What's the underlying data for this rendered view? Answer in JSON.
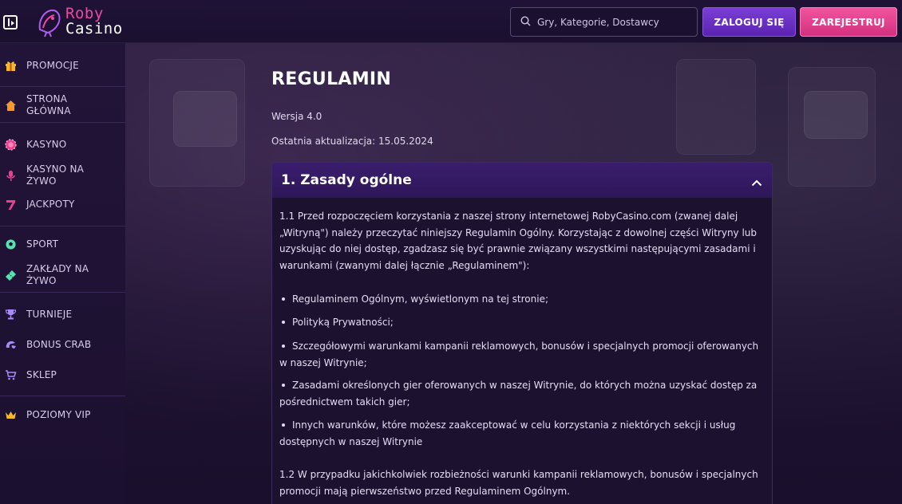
{
  "header": {
    "logo_line1": "Roby",
    "logo_line2": "Casino",
    "search_placeholder": "Gry, Kategorie, Dostawcy",
    "login_label": "ZALOGUJ SIĘ",
    "register_label": "ZAREJESTRUJ"
  },
  "sidebar": {
    "items": [
      {
        "label": "PROMOCJE",
        "icon": "gift-icon"
      },
      {
        "label": "STRONA GŁÓWNA",
        "icon": "home-icon"
      },
      {
        "label": "KASYNO",
        "icon": "casino-chip-icon"
      },
      {
        "label": "KASYNO NA ŻYWO",
        "icon": "microphone-icon"
      },
      {
        "label": "JACKPOTY",
        "icon": "seven-icon"
      },
      {
        "label": "SPORT",
        "icon": "football-icon"
      },
      {
        "label": "ZAKŁADY NA ŻYWO",
        "icon": "ticket-icon"
      },
      {
        "label": "TURNIEJE",
        "icon": "trophy-icon"
      },
      {
        "label": "BONUS CRAB",
        "icon": "crab-claw-icon"
      },
      {
        "label": "SKLEP",
        "icon": "cart-icon"
      },
      {
        "label": "POZIOMY VIP",
        "icon": "crown-icon"
      }
    ]
  },
  "main": {
    "title": "REGULAMIN",
    "version": "Wersja 4.0",
    "last_update": "Ostatnia aktualizacja: 15.05.2024",
    "section": {
      "title": "1.  Zasady ogólne",
      "p1": "1.1 Przed rozpoczęciem korzystania z naszej strony internetowej RobyCasino.com (zwanej dalej „Witryną\") należy przeczytać niniejszy Regulamin Ogólny. Korzystając z dowolnej części Witryny lub uzyskując do niej dostęp, zgadzasz się być prawnie związany wszystkimi następującymi zasadami i warunkami (zwanymi dalej łącznie „Regulaminem\"):",
      "bullets": [
        "Regulaminem Ogólnym, wyświetlonym na tej stronie;",
        "Polityką Prywatności;",
        "Szczegółowymi warunkami kampanii reklamowych, bonusów i specjalnych promocji oferowanych w naszej Witrynie;",
        "Zasadami określonych gier oferowanych w naszej Witrynie, do których można uzyskać dostęp za pośrednictwem takich gier;",
        "Innych warunków, które możesz zaakceptować w celu korzystania z niektórych sekcji i usług dostępnych w naszej Witrynie"
      ],
      "p2": "1.2 W przypadku jakichkolwiek rozbieżności warunki kampanii reklamowych, bonusów i specjalnych promocji mają pierwszeństwo przed Regulaminem Ogólnym."
    }
  },
  "colors": {
    "accent_purple": "#6a2fc4",
    "accent_pink": "#e8438f",
    "background": "#1a0f2e"
  }
}
